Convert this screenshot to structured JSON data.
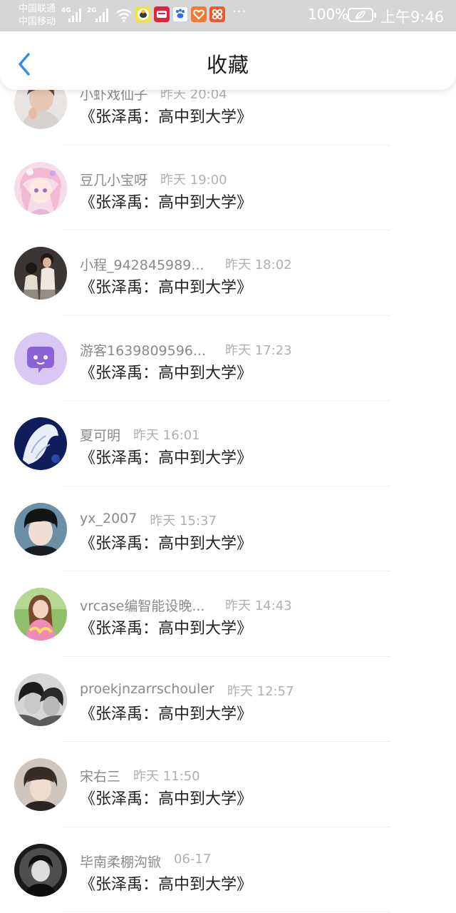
{
  "status_bar": {
    "carrier_1": "中国联通",
    "carrier_2": "中国移动",
    "net_1": "4G",
    "net_2": "2G",
    "apps": [
      {
        "icon": "bee-app-icon",
        "color": "#f5e04a"
      },
      {
        "icon": "shop-app-icon",
        "color": "#e3233b"
      },
      {
        "icon": "paw-app-icon",
        "color": "#2f6fe0"
      },
      {
        "icon": "heart-app-icon",
        "color": "#f17a35"
      },
      {
        "icon": "grid-app-icon",
        "color": "#f05a2a"
      }
    ],
    "more": "···",
    "battery": "100%",
    "time": "上午9:46"
  },
  "header": {
    "title": "收藏"
  },
  "items": [
    {
      "name": "小虾戏仙子",
      "time": "昨天 20:04",
      "content": "《张泽禹：高中到大学》",
      "avatar": "person"
    },
    {
      "name": "豆几小宝呀",
      "time": "昨天 19:00",
      "content": "《张泽禹：高中到大学》",
      "avatar": "anime"
    },
    {
      "name": "小程_942845989...",
      "time": "昨天 18:02",
      "content": "《张泽禹：高中到大学》",
      "avatar": "couple"
    },
    {
      "name": "游客1639809596...",
      "time": "昨天 17:23",
      "content": "《张泽禹：高中到大学》",
      "avatar": "chat"
    },
    {
      "name": "夏可明",
      "time": "昨天 16:01",
      "content": "《张泽禹：高中到大学》",
      "avatar": "blue"
    },
    {
      "name": "yx_2007",
      "time": "昨天 15:37",
      "content": "《张泽禹：高中到大学》",
      "avatar": "boy"
    },
    {
      "name": "vrcase编智能设晚...",
      "time": "昨天 14:43",
      "content": "《张泽禹：高中到大学》",
      "avatar": "girl"
    },
    {
      "name": "proekjnzarrschouler",
      "time": "昨天 12:57",
      "content": "《张泽禹：高中到大学》",
      "avatar": "bw"
    },
    {
      "name": "宋右三",
      "time": "昨天 11:50",
      "content": "《张泽禹：高中到大学》",
      "avatar": "boy2"
    },
    {
      "name": "毕南柔棚沟锨",
      "time": "06-17",
      "content": "《张泽禹：高中到大学》",
      "avatar": "dark"
    }
  ]
}
